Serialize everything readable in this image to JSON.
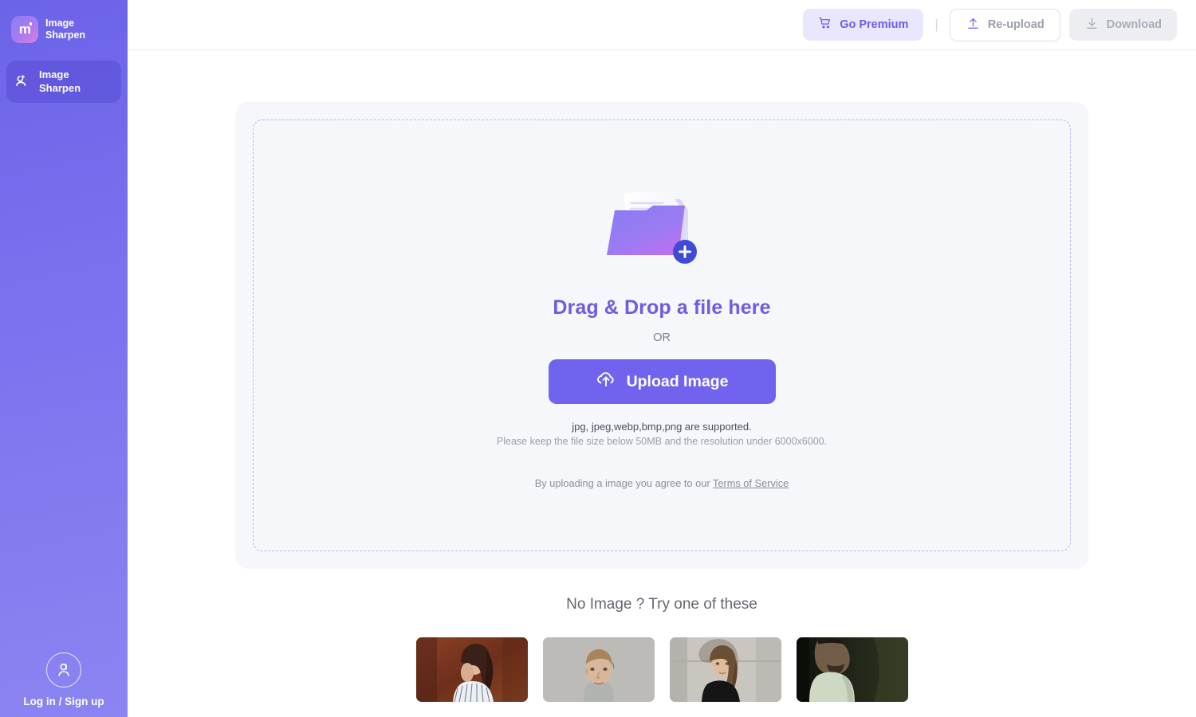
{
  "sidebar": {
    "brand": {
      "title": "Image\nSharpen",
      "logo_glyph": "m",
      "logo_icon": "app-logo-icon"
    },
    "items": [
      {
        "label": "Image\nSharpen",
        "icon": "sharpen-portrait-icon",
        "active": true
      }
    ],
    "login": {
      "label": "Log in / Sign up",
      "icon": "user-avatar-icon"
    }
  },
  "topbar": {
    "premium_label": "Go Premium",
    "premium_icon": "cart-icon",
    "separator": "|",
    "reupload_label": "Re-upload",
    "reupload_icon": "upload-arrow-icon",
    "download_label": "Download",
    "download_icon": "download-icon"
  },
  "dropzone": {
    "folder_icon": "folder-add-illustration",
    "title": "Drag & Drop a file here",
    "or": "OR",
    "upload_label": "Upload Image",
    "upload_icon": "cloud-upload-icon",
    "formats_hint": "jpg, jpeg,webp,bmp,png are supported.",
    "size_hint": "Please keep the file size below 50MB and the resolution under 6000x6000.",
    "tos_prefix": "By uploading a image you agree to our ",
    "tos_link": "Terms of Service"
  },
  "samples": {
    "title": "No Image ? Try one of these",
    "items": [
      {
        "name": "sample-woman-curly-hair-red-wood",
        "bg": "#7d3a22",
        "skin": "#e2b79a",
        "hair": "#3a2018",
        "cloth": "#eceff3"
      },
      {
        "name": "sample-man-grey-background",
        "bg": "#b9b8b4",
        "skin": "#d9b79b",
        "hair": "#a9845a",
        "cloth": "#b0b3b0"
      },
      {
        "name": "sample-woman-black-top-concrete",
        "bg": "#c9c6c0",
        "skin": "#e0bc9f",
        "hair": "#6b4f35",
        "cloth": "#151515"
      },
      {
        "name": "sample-man-dark-moody-sage",
        "bg": "#171a12",
        "skin": "#7b6450",
        "hair": "#20170f",
        "cloth": "#cfd8c2"
      }
    ]
  },
  "colors": {
    "accent": "#6c5ce7",
    "accent_solid": "#7064ef",
    "sidebar_from": "#6c63e8",
    "sidebar_to": "#8b85f2",
    "premium_bg": "#e9e7fd",
    "disabled_bg": "#eceef2",
    "card_bg": "#f6f7fb",
    "dash_border": "#b9b6ef"
  }
}
